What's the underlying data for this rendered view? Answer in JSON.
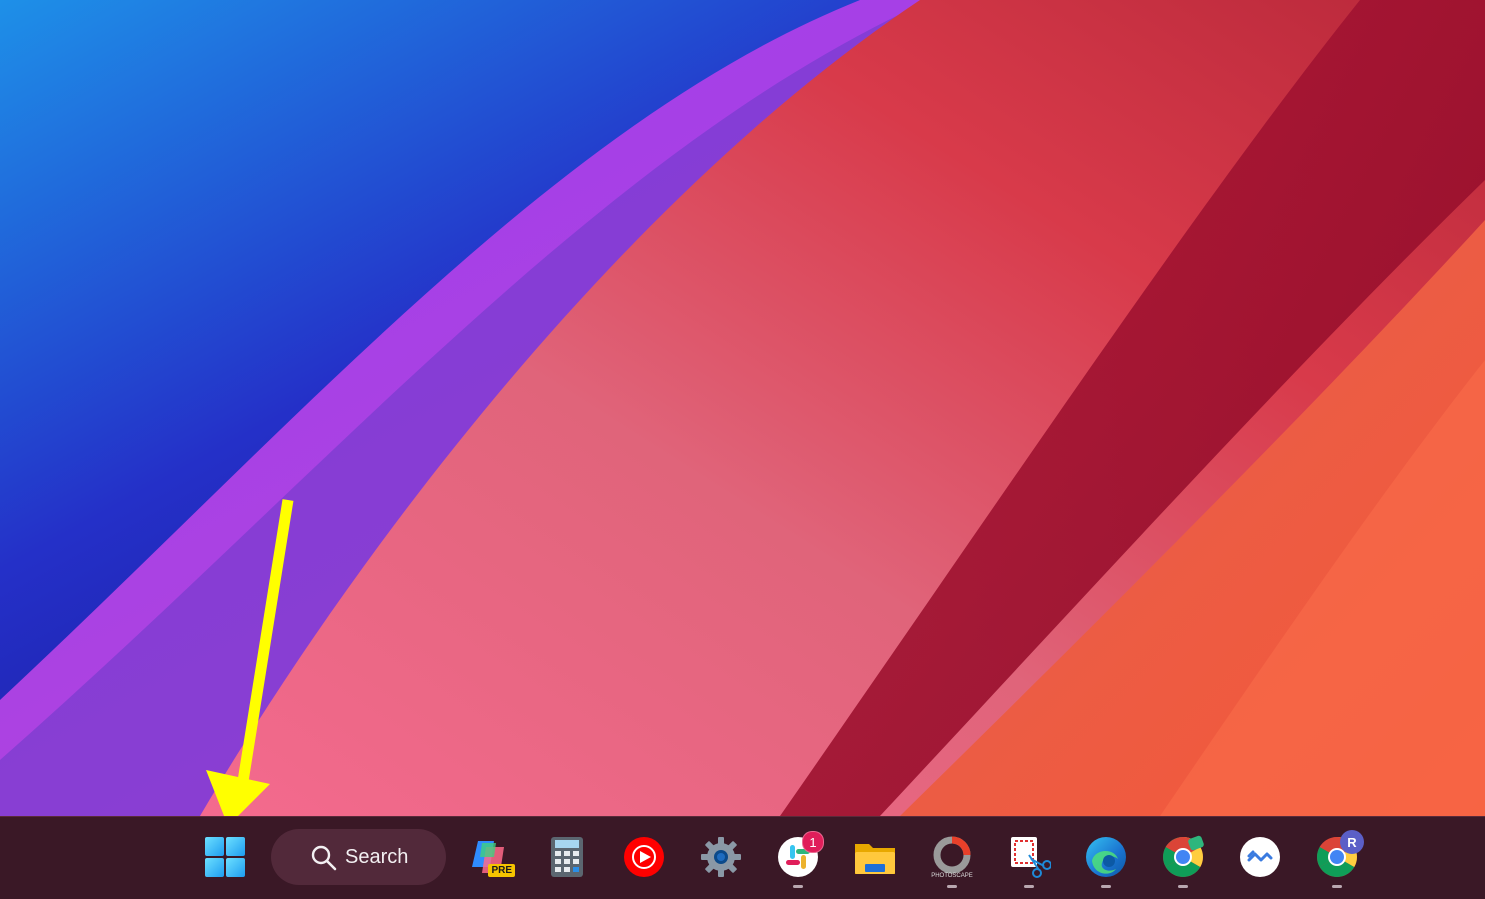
{
  "desktop": {
    "wallpaper_colors": [
      "#1e88e5",
      "#2b1ca8",
      "#8a2be2",
      "#e8607a",
      "#c8102e",
      "#f25a3c"
    ],
    "annotation_arrow_color": "#ffff00"
  },
  "taskbar": {
    "background": "#3a1826",
    "start": {
      "icon": "windows-logo-icon"
    },
    "search": {
      "label": "Search",
      "icon": "search-icon"
    },
    "apps": [
      {
        "name": "Copilot",
        "icon": "copilot-icon",
        "badge": "PRE",
        "running": false
      },
      {
        "name": "Calculator",
        "icon": "calculator-icon",
        "running": false
      },
      {
        "name": "YouTube Music",
        "icon": "youtube-music-icon",
        "running": false
      },
      {
        "name": "Settings",
        "icon": "gear-icon",
        "running": false
      },
      {
        "name": "Slack",
        "icon": "slack-icon",
        "badge": "1",
        "running": true
      },
      {
        "name": "File Explorer",
        "icon": "folder-icon",
        "running": false
      },
      {
        "name": "PhotoScape",
        "icon": "photoscape-icon",
        "label": "PHOTOSCAPE",
        "running": true
      },
      {
        "name": "Snipping Tool",
        "icon": "snipping-tool-icon",
        "running": true
      },
      {
        "name": "Microsoft Edge",
        "icon": "edge-icon",
        "running": true
      },
      {
        "name": "Google Chrome",
        "icon": "chrome-icon",
        "running": true
      },
      {
        "name": "Phone Link",
        "icon": "phone-link-icon",
        "running": false
      },
      {
        "name": "Google Chrome Profile",
        "icon": "chrome-icon",
        "badge": "R",
        "running": true
      }
    ]
  }
}
